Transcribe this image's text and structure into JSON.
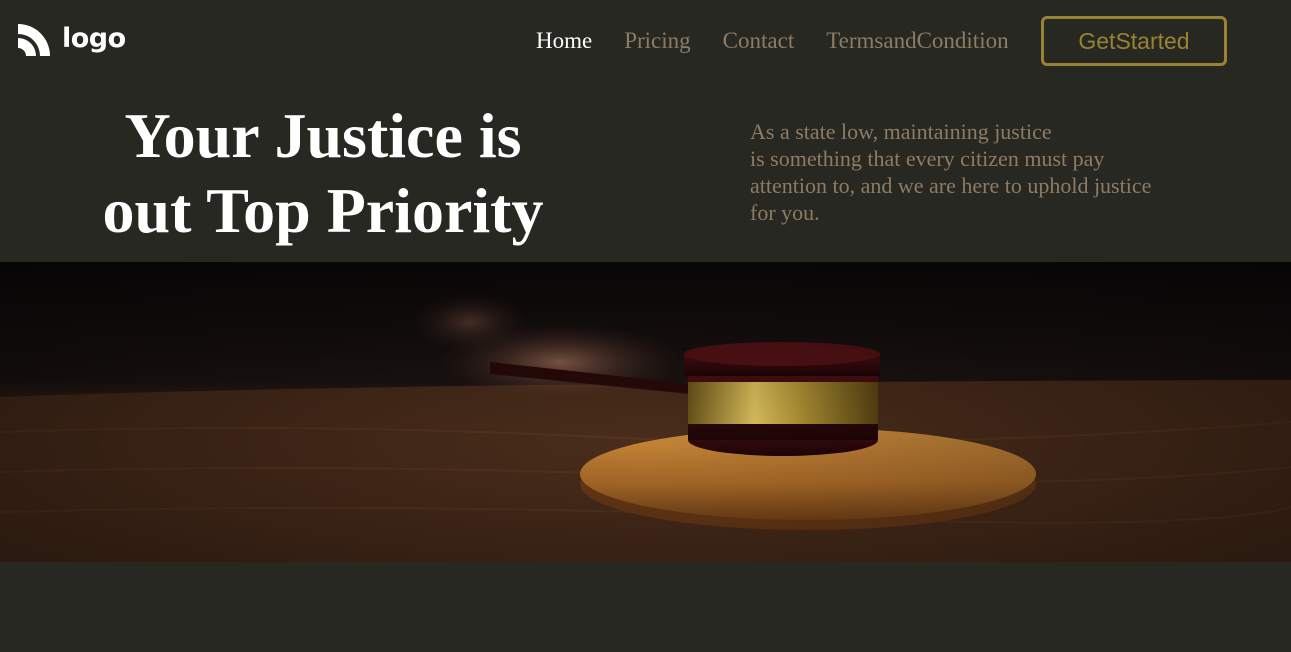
{
  "header": {
    "logo_text": "logo",
    "nav": [
      {
        "label": "Home",
        "active": true
      },
      {
        "label": "Pricing",
        "active": false
      },
      {
        "label": "Contact",
        "active": false
      },
      {
        "label": "TermsandCondition",
        "active": false
      }
    ],
    "cta_label": "GetStarted"
  },
  "hero": {
    "title_line1": "Your Justice is",
    "title_line2": "out Top Priority",
    "description_lines": [
      "As a state low, maintaining justice",
      "is something that every citizen must pay",
      "attention to, and we are here to uphold justice",
      "for you."
    ],
    "image_icon": "gavel-image"
  },
  "colors": {
    "background": "#282822",
    "accent": "#978333",
    "muted_text": "#8d7b64",
    "text": "#ffffff"
  }
}
